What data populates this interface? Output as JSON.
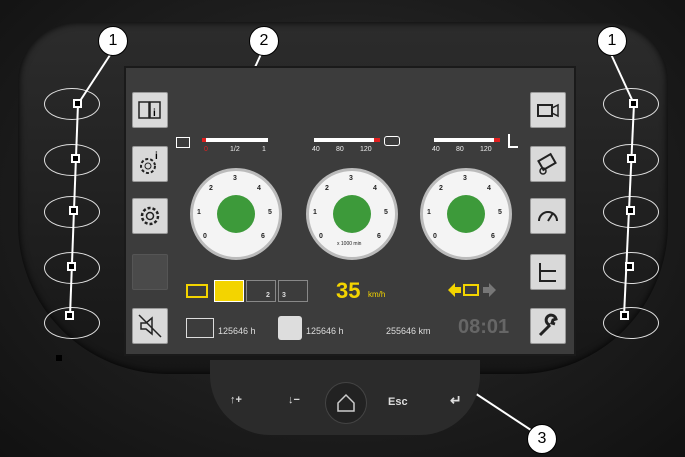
{
  "callouts": [
    "1",
    "2",
    "1",
    "3"
  ],
  "bars": {
    "fuel": {
      "labels": [
        "0",
        "1/2",
        "1"
      ],
      "fill": 0.02
    },
    "temp1": {
      "labels": [
        "40",
        "80",
        "120"
      ],
      "fill": 0.9
    },
    "temp2": {
      "labels": [
        "40",
        "80",
        "120"
      ],
      "fill": 0.9
    }
  },
  "gauges": [
    {
      "numbers": [
        "0",
        "1",
        "2",
        "3",
        "4",
        "5",
        "6"
      ]
    },
    {
      "numbers": [
        "0",
        "1",
        "2",
        "3",
        "4",
        "5",
        "6"
      ],
      "unit": "x 1000 min"
    },
    {
      "numbers": [
        "0",
        "1",
        "2",
        "3",
        "4",
        "5",
        "6"
      ]
    }
  ],
  "gear_labels": {
    "g2": "2",
    "g3": "3"
  },
  "speed": {
    "value": "35",
    "unit": "km/h"
  },
  "status": {
    "hours1": "125646 h",
    "hours2": "125646 h",
    "distance": "255646 km",
    "time": "08:01"
  },
  "keys": {
    "esc": "Esc"
  },
  "colors": {
    "accent": "#f3d400",
    "green": "#3d9a3a",
    "red": "#e02020"
  }
}
